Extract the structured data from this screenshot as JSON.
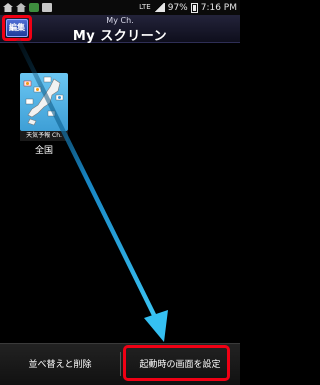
{
  "statusbar": {
    "network": "LTE",
    "battery": "97%",
    "time": "7:16 PM"
  },
  "header": {
    "subtitle": "My Ch.",
    "title": "My スクリーン",
    "edit_label": "編集"
  },
  "tiles": [
    {
      "caption": "天気予報 Ch.",
      "label": "全国"
    }
  ],
  "bottom": {
    "sort_delete_label": "並べ替えと削除",
    "startup_screen_label": "起動時の画面を設定"
  },
  "colors": {
    "highlight": "#f00014",
    "arrow": "#1fa7e6"
  }
}
